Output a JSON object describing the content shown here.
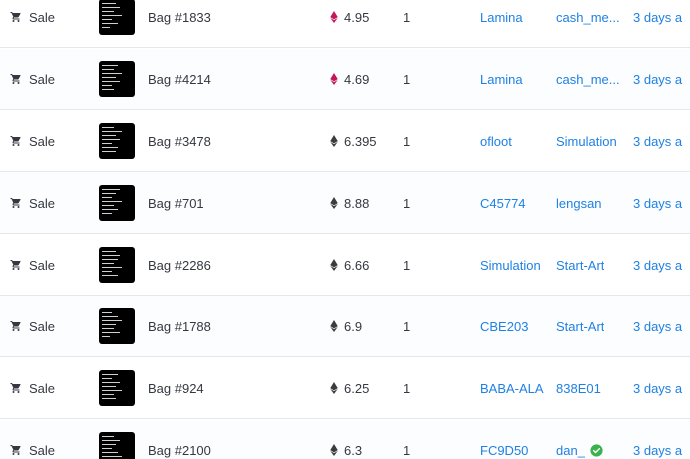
{
  "colors": {
    "link": "#2081e2",
    "text": "#353840",
    "verified": "#3ab24e",
    "weth": "#c2185b",
    "eth": "#3c3c3d"
  },
  "rows": [
    {
      "event": "Sale",
      "event_icon": "cart-icon",
      "item": "Bag #1833",
      "currency_icon": "weth-icon",
      "price": "4.95",
      "qty": "1",
      "from": "Lamina",
      "to": "cash_me...",
      "time": "3 days a"
    },
    {
      "event": "Sale",
      "event_icon": "cart-icon",
      "item": "Bag #4214",
      "currency_icon": "weth-icon",
      "price": "4.69",
      "qty": "1",
      "from": "Lamina",
      "to": "cash_me...",
      "time": "3 days a"
    },
    {
      "event": "Sale",
      "event_icon": "cart-icon",
      "item": "Bag #3478",
      "currency_icon": "eth-icon",
      "price": "6.395",
      "qty": "1",
      "from": "ofloot",
      "to": "Simulation",
      "time": "3 days a"
    },
    {
      "event": "Sale",
      "event_icon": "cart-icon",
      "item": "Bag #701",
      "currency_icon": "eth-icon",
      "price": "8.88",
      "qty": "1",
      "from": "C45774",
      "to": "lengsan",
      "time": "3 days a"
    },
    {
      "event": "Sale",
      "event_icon": "cart-icon",
      "item": "Bag #2286",
      "currency_icon": "eth-icon",
      "price": "6.66",
      "qty": "1",
      "from": "Simulation",
      "to": "Start-Art",
      "time": "3 days a"
    },
    {
      "event": "Sale",
      "event_icon": "cart-icon",
      "item": "Bag #1788",
      "currency_icon": "eth-icon",
      "price": "6.9",
      "qty": "1",
      "from": "CBE203",
      "to": "Start-Art",
      "time": "3 days a"
    },
    {
      "event": "Sale",
      "event_icon": "cart-icon",
      "item": "Bag #924",
      "currency_icon": "eth-icon",
      "price": "6.25",
      "qty": "1",
      "from": "BABA-ALA",
      "to": "838E01",
      "time": "3 days a"
    },
    {
      "event": "Sale",
      "event_icon": "cart-icon",
      "item": "Bag #2100",
      "currency_icon": "eth-icon",
      "price": "6.3",
      "qty": "1",
      "from": "FC9D50",
      "to": "dan_",
      "to_verified": true,
      "time": "3 days a"
    }
  ]
}
